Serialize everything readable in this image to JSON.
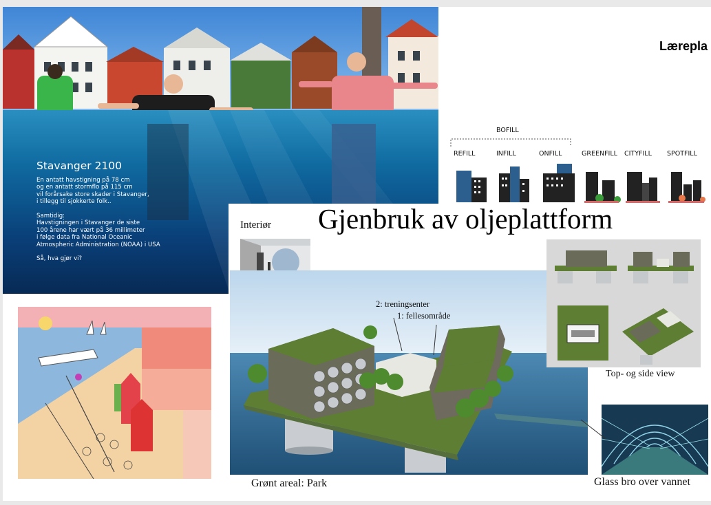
{
  "header": {
    "title_fragment": "Lærepla"
  },
  "stavanger": {
    "title": "Stavanger 2100",
    "lines": [
      "En antatt havstigning på 78 cm",
      "og en antatt stormflo på 115 cm",
      "vil forårsake store skader i Stavanger,",
      "i tillegg til sjokkerte folk..",
      "",
      "Samtidig:",
      "Havstigningen i Stavanger de siste",
      "100 årene har vært på 36 millimeter",
      "i følge data fra National Oceanic",
      "Atmospheric Administration (NOAA) i USA",
      "",
      "Så, hva gjør vi?"
    ]
  },
  "bofill": {
    "group_label": "BOFILL",
    "items": [
      {
        "label": "REFILL"
      },
      {
        "label": "INFILL"
      },
      {
        "label": "ONFILL"
      },
      {
        "label": "GREENFILL"
      },
      {
        "label": "CITYFILL"
      },
      {
        "label": "SPOTFILL"
      }
    ]
  },
  "platform": {
    "title": "Gjenbruk av oljeplattform",
    "interior_label": "Interiør",
    "label_training": "2: treningsenter",
    "label_common": "1: fellesområde",
    "caption_park": "Grønt areal: Park",
    "caption_views": "Top- og side view",
    "caption_bridge": "Glass bro over vannet"
  },
  "colors": {
    "accent_blue": "#2d5f8e",
    "green_roof": "#5d7e33",
    "water": "#2f6f98"
  }
}
